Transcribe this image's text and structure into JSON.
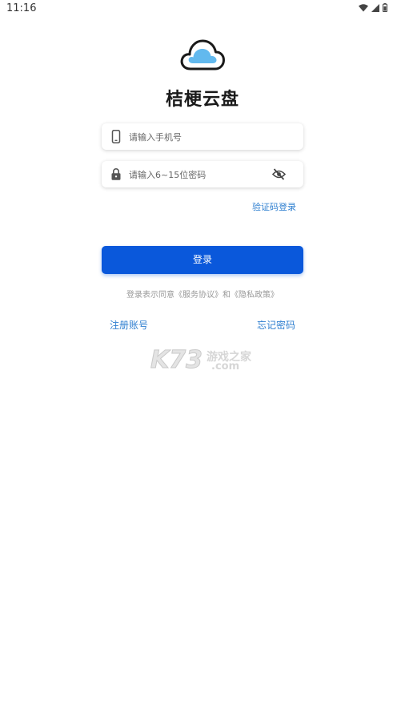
{
  "status_bar": {
    "time": "11:16",
    "icons": [
      "wifi-icon",
      "signal-icon",
      "battery-icon"
    ]
  },
  "app": {
    "title": "桔梗云盘",
    "logo": "cloud-icon",
    "accent": "#0a58db",
    "link_color": "#2f7fd0"
  },
  "form": {
    "phone": {
      "icon": "phone-icon",
      "placeholder": "请输入手机号"
    },
    "password": {
      "icon": "lock-icon",
      "placeholder": "请输入6~15位密码",
      "toggle_icon": "eye-off-icon"
    },
    "code_login": "验证码登录",
    "login_button": "登录",
    "agreement": "登录表示同意《服务协议》和《隐私政策》"
  },
  "links": {
    "register": "注册账号",
    "forgot": "忘记密码"
  },
  "watermark": {
    "brand": "K73",
    "cn": "游戏之家",
    "domain": ".com"
  }
}
